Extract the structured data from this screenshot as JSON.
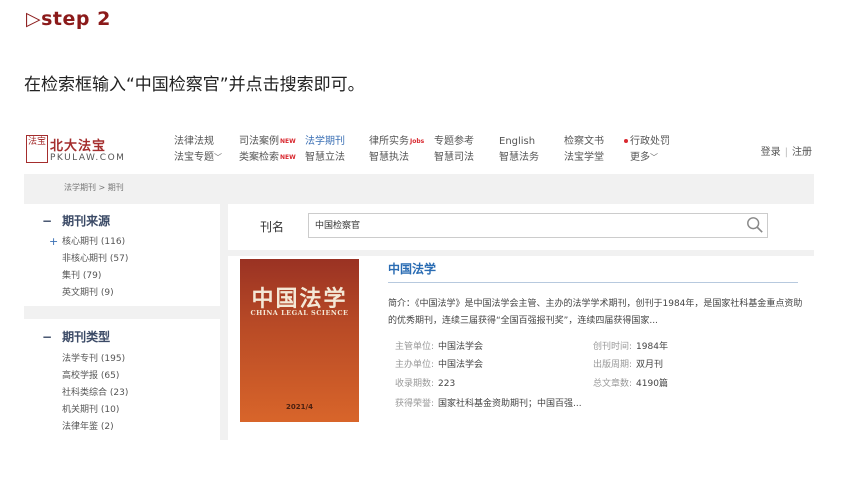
{
  "step": "▷step 2",
  "instruction": "在检索框输入“中国检察官”并点击搜索即可。",
  "nav": {
    "logo_mark": "法宝",
    "logo_title": "北大法宝",
    "logo_sub": "PKULAW.COM",
    "columns": [
      {
        "top": "法律法规",
        "bottom": "法宝专题",
        "top_badge": "",
        "bottom_badge": "",
        "bottom_chevron": true
      },
      {
        "top": "司法案例",
        "bottom": "类案检索",
        "top_badge": "NEW",
        "bottom_badge": "NEW"
      },
      {
        "top": "法学期刊",
        "bottom": "智慧立法",
        "active": true
      },
      {
        "top": "律所实务",
        "bottom": "智慧执法",
        "top_badge": "Jobs"
      },
      {
        "top": "专题参考",
        "bottom": "智慧司法"
      },
      {
        "top": "English",
        "bottom": "智慧法务"
      },
      {
        "top": "检察文书",
        "bottom": "法宝学堂"
      },
      {
        "top": "行政处罚",
        "bottom": "更多"
      }
    ],
    "login": "登录",
    "register": "注册"
  },
  "breadcrumb": "法学期刊 > 期刊",
  "source_section": {
    "title": "期刊来源",
    "items": [
      {
        "label": "核心期刊",
        "count": "(116)"
      },
      {
        "label": "非核心期刊",
        "count": "(57)"
      },
      {
        "label": "集刊",
        "count": "(79)"
      },
      {
        "label": "英文期刊",
        "count": "(9)"
      }
    ]
  },
  "type_section": {
    "title": "期刊类型",
    "items": [
      {
        "label": "法学专刊",
        "count": "(195)"
      },
      {
        "label": "高校学报",
        "count": "(65)"
      },
      {
        "label": "社科类综合",
        "count": "(23)"
      },
      {
        "label": "机关期刊",
        "count": "(10)"
      },
      {
        "label": "法律年鉴",
        "count": "(2)"
      }
    ]
  },
  "search": {
    "label": "刊名",
    "value": "中国检察官"
  },
  "journal": {
    "cover_title": "中国法学",
    "cover_en": "CHINA LEGAL SCIENCE",
    "cover_year": "2021/4",
    "title": "中国法学",
    "desc": "简介：《中国法学》是中国法学会主管、主办的法学学术期刊，创刊于1984年，是国家社科基金重点资助的优秀期刊，连续三届获得“全国百强报刊奖”，连续四届获得国家...",
    "fields": [
      {
        "k": "主管单位:",
        "v": "中国法学会"
      },
      {
        "k": "创刊时间:",
        "v": "1984年"
      },
      {
        "k": "主办单位:",
        "v": "中国法学会"
      },
      {
        "k": "出版周期:",
        "v": "双月刊"
      },
      {
        "k": "收录期数:",
        "v": "223"
      },
      {
        "k": "总文章数:",
        "v": "4190篇"
      },
      {
        "k": "获得荣誉:",
        "v": "国家社科基金资助期刊；中国百强..."
      }
    ]
  },
  "colors": {
    "accent": "#8b1a1a",
    "link": "#2a6cb3",
    "new_badge": "#d9282f"
  }
}
